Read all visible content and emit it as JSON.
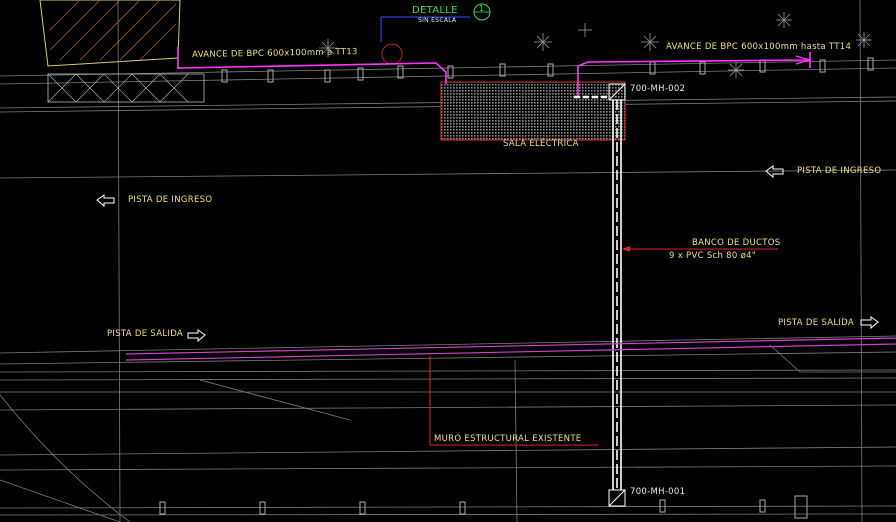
{
  "detail": {
    "title": "DETALLE",
    "subtitle": "SIN ESCALA",
    "number": "1"
  },
  "labels": {
    "avance_left": "AVANCE DE BPC 600x100mm a TT13",
    "avance_right": "AVANCE DE BPC 600x100mm hasta TT14",
    "sala": "SALA ELÉCTRICA",
    "mh_top": "700-MH-002",
    "mh_bottom": "700-MH-001",
    "pista_ingreso_left": "PISTA DE INGRESO",
    "pista_ingreso_right": "PISTA DE INGRESO",
    "pista_salida_left": "PISTA DE SALIDA",
    "pista_salida_right": "PISTA DE SALIDA",
    "banco_line1": "BANCO DE DUCTOS",
    "banco_line2": "9 x PVC Sch 80 ø4\"",
    "muro": "MURO ESTRUCTURAL EXISTENTE"
  },
  "colors": {
    "background": "#000000",
    "grid_line": "#8a8a8a",
    "conduit_magenta": "#ff33ff",
    "annotation_yellow": "#f0e070",
    "leader_red": "#e02020",
    "detail_green": "#33e050",
    "detail_blue": "#3050ff"
  }
}
